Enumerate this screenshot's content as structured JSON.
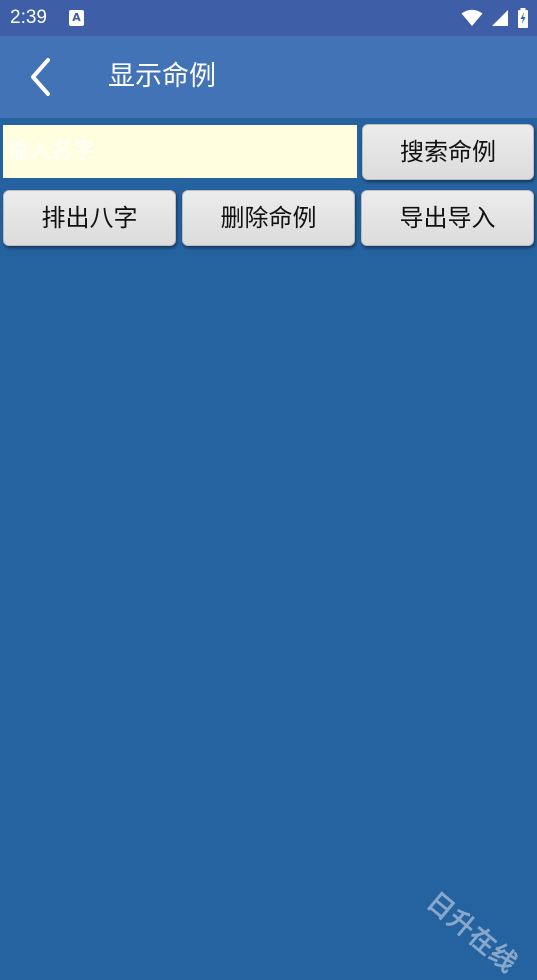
{
  "status_bar": {
    "time": "2:39",
    "notification_icon": "A",
    "icons": [
      "wifi-icon",
      "signal-icon",
      "battery-icon"
    ]
  },
  "app_bar": {
    "back_icon": "chevron-left-icon",
    "title": "显示命例"
  },
  "search": {
    "placeholder": "输入名字",
    "button_label": "搜索命例"
  },
  "actions": {
    "paipan_label": "排出八字",
    "delete_label": "删除命例",
    "import_export_label": "导出导入"
  },
  "watermark": "日升在线",
  "colors": {
    "status_bar": "#3E5FA8",
    "app_bar": "#4273B7",
    "background": "#2562A0",
    "input_background": "#FFFFE0",
    "button_background": "#E4E4E4"
  }
}
